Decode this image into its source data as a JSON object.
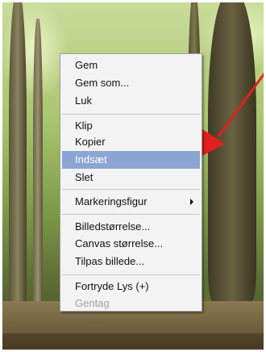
{
  "context_menu": {
    "items": [
      {
        "label": "Gem"
      },
      {
        "label": "Gem som..."
      },
      {
        "label": "Luk"
      },
      {
        "label": "Klip"
      },
      {
        "label": "Kopier"
      },
      {
        "label": "Indsæt",
        "highlighted": true
      },
      {
        "label": "Slet"
      },
      {
        "label": "Markeringsfigur",
        "has_submenu": true
      },
      {
        "label": "Billedstørrelse..."
      },
      {
        "label": "Canvas størrelse..."
      },
      {
        "label": "Tilpas billede..."
      },
      {
        "label": "Fortryde Lys (+)"
      },
      {
        "label": "Gentag",
        "disabled": true
      }
    ]
  },
  "colors": {
    "highlight": "#8ba6d2",
    "arrow": "#e02020"
  },
  "annotation": {
    "icon": "red-arrow-icon",
    "points_to": "Indsæt"
  }
}
